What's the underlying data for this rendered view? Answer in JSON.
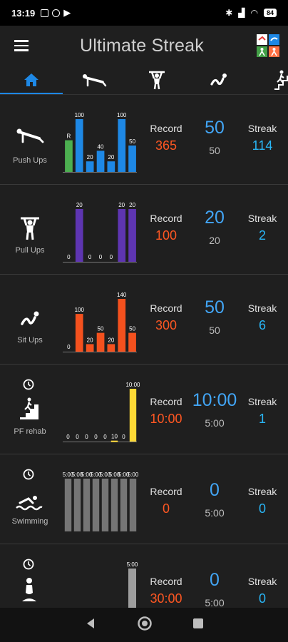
{
  "status_bar": {
    "time": "13:19",
    "battery": "84"
  },
  "app": {
    "title": "Ultimate Streak"
  },
  "tabs": [
    "home-icon",
    "push-up-icon",
    "pull-up-icon",
    "sit-up-icon",
    "stairs-icon"
  ],
  "colors": {
    "accent": "#1e88e5",
    "record": "#ff5722",
    "goal": "#42a5f5",
    "streak": "#29b6f6"
  },
  "labels": {
    "record": "Record",
    "streak": "Streak"
  },
  "exercises": [
    {
      "name": "Push Ups",
      "icon": "push-up-icon",
      "has_clock": false,
      "record": "365",
      "goal": "50",
      "today": "50",
      "streak": "114",
      "bar_labels": [
        "R",
        "100",
        "20",
        "40",
        "20",
        "100",
        "50"
      ],
      "bar_values": [
        60,
        100,
        20,
        40,
        20,
        100,
        50
      ],
      "bar_colors": [
        "#4caf50",
        "#1e88e5",
        "#1e88e5",
        "#1e88e5",
        "#1e88e5",
        "#1e88e5",
        "#1e88e5"
      ],
      "bar_max": 100
    },
    {
      "name": "Pull Ups",
      "icon": "pull-up-icon",
      "has_clock": false,
      "record": "100",
      "goal": "20",
      "today": "20",
      "streak": "2",
      "bar_labels": [
        "0",
        "20",
        "0",
        "0",
        "0",
        "20",
        "20"
      ],
      "bar_values": [
        0,
        20,
        0,
        0,
        0,
        20,
        20
      ],
      "bar_colors": [
        "#5e35b1",
        "#5e35b1",
        "#5e35b1",
        "#5e35b1",
        "#5e35b1",
        "#5e35b1",
        "#5e35b1"
      ],
      "bar_max": 20
    },
    {
      "name": "Sit Ups",
      "icon": "sit-up-icon",
      "has_clock": false,
      "record": "300",
      "goal": "50",
      "today": "50",
      "streak": "6",
      "bar_labels": [
        "0",
        "100",
        "20",
        "50",
        "20",
        "140",
        "50"
      ],
      "bar_values": [
        0,
        100,
        20,
        50,
        20,
        140,
        50
      ],
      "bar_colors": [
        "#f4511e",
        "#f4511e",
        "#f4511e",
        "#f4511e",
        "#f4511e",
        "#f4511e",
        "#f4511e"
      ],
      "bar_max": 140
    },
    {
      "name": "PF rehab",
      "icon": "stairs-icon",
      "has_clock": true,
      "record": "10:00",
      "goal": "10:00",
      "today": "5:00",
      "streak": "1",
      "bar_labels": [
        "0",
        "0",
        "0",
        "0",
        "0",
        "10",
        "0",
        "10:00"
      ],
      "bar_values": [
        0,
        0,
        0,
        0,
        0,
        0.17,
        0,
        10
      ],
      "bar_colors": [
        "#fdd835",
        "#fdd835",
        "#fdd835",
        "#fdd835",
        "#fdd835",
        "#fdd835",
        "#fdd835",
        "#fdd835"
      ],
      "bar_max": 10
    },
    {
      "name": "Swimming",
      "icon": "swimmer-icon",
      "has_clock": true,
      "record": "0",
      "goal": "0",
      "today": "5:00",
      "streak": "0",
      "bar_labels": [
        "5:00",
        "5:00",
        "5:00",
        "5:00",
        "5:00",
        "5:00",
        "5:00",
        "5:00"
      ],
      "bar_values": [
        5,
        5,
        5,
        5,
        5,
        5,
        5,
        5
      ],
      "bar_colors": [
        "#757575",
        "#757575",
        "#757575",
        "#757575",
        "#757575",
        "#757575",
        "#757575",
        "#757575"
      ],
      "bar_max": 5
    },
    {
      "name": "",
      "icon": "yoga-icon",
      "has_clock": true,
      "record": "30:00",
      "goal": "0",
      "today": "5:00",
      "streak": "0",
      "bar_labels": [
        "5:00"
      ],
      "bar_values": [
        5
      ],
      "bar_colors": [
        "#9e9e9e"
      ],
      "bar_max": 5
    }
  ],
  "nav": [
    "back-icon",
    "home-circle-icon",
    "recents-icon"
  ]
}
